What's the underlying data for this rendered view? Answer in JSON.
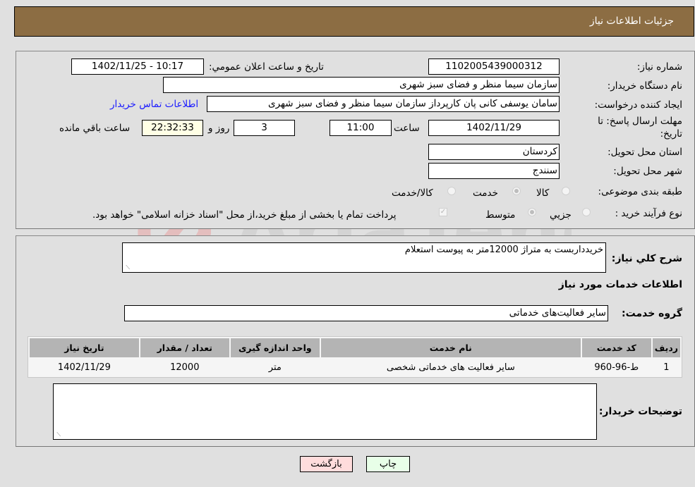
{
  "header": {
    "title": "جزئیات اطلاعات نیاز"
  },
  "form": {
    "need_number": {
      "label": "شماره نیاز:",
      "value": "1102005439000312"
    },
    "announce_datetime": {
      "label": "تاریخ و ساعت اعلان عمومي:",
      "value": "1402/11/25 - 10:17"
    },
    "buyer_org": {
      "label": "نام دستگاه خریدار:",
      "value": "سازمان سیما  منظر و فضای سبز شهری"
    },
    "requester": {
      "label": "ایجاد کننده درخواست:",
      "value": "سامان یوسفی کانی پان کارپرداز سازمان سیما  منظر و فضای سبز شهری"
    },
    "buyer_contact_link": "اطلاعات تماس خریدار",
    "deadline": {
      "label": "مهلت ارسال پاسخ: تا تاریخ:",
      "date": "1402/11/29",
      "time_label": "ساعت",
      "time": "11:00",
      "days": "3",
      "days_label": "روز و",
      "remaining": "22:32:33",
      "remaining_label": "ساعت باقي مانده"
    },
    "province": {
      "label": "استان محل تحویل:",
      "value": "کردستان"
    },
    "city": {
      "label": "شهر محل تحویل:",
      "value": "سنندج"
    },
    "category": {
      "label": "طبقه بندی موضوعی:",
      "options": [
        "کالا",
        "خدمت",
        "کالا/خدمت"
      ],
      "selected": "خدمت"
    },
    "purchase_process": {
      "label": "نوع فرآیند خرید :",
      "options": [
        "جزيي",
        "متوسط"
      ],
      "selected": "متوسط",
      "treasury_checkbox_label": "پرداخت تمام یا بخشی از مبلغ خرید،از محل \"اسناد خزانه اسلامی\" خواهد بود.",
      "treasury_checked": true
    }
  },
  "details": {
    "description_label": "شرح کلي نیاز:",
    "description": "خریدداربست به متراژ 12000متر به پیوست استعلام",
    "services_heading": "اطلاعات خدمات مورد نیاز",
    "service_group_label": "گروه خدمت:",
    "service_group": "سایر فعالیت‌های خدماتی",
    "table": {
      "headers": [
        "ردیف",
        "کد خدمت",
        "نام خدمت",
        "واحد اندازه گیری",
        "تعداد / مقدار",
        "تاریخ نیاز"
      ],
      "rows": [
        [
          "1",
          "ط-96-960",
          "سایر فعالیت های خدماتی شخصی",
          "متر",
          "12000",
          "1402/11/29"
        ]
      ]
    },
    "buyer_notes_label": "توضیحات خریدار:",
    "buyer_notes": ""
  },
  "buttons": {
    "print": "چاپ",
    "back": "بازگشت"
  },
  "watermark": {
    "text": "AriaTender.neT"
  }
}
